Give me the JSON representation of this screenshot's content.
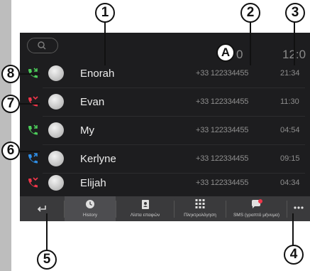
{
  "top": {
    "right_partial": "0",
    "time_partial": "12:0"
  },
  "calls": [
    {
      "name": "Enorah",
      "number": "+33 122334455",
      "time": "21:34",
      "type": "incoming",
      "color": "#4ccb5a"
    },
    {
      "name": "Evan",
      "number": "+33 122334455",
      "time": "11:30",
      "type": "missed",
      "color": "#f0364a"
    },
    {
      "name": "My",
      "number": "+33 122334455",
      "time": "04:54",
      "type": "incoming",
      "color": "#4ccb5a"
    },
    {
      "name": "Kerlyne",
      "number": "+33 122334455",
      "time": "09:15",
      "type": "outgoing",
      "color": "#2f8fe8"
    },
    {
      "name": "Elijah",
      "number": "+33 122334455",
      "time": "04:34",
      "type": "missed",
      "color": "#f0364a"
    }
  ],
  "tabs": [
    {
      "label": "History",
      "icon": "clock-icon"
    },
    {
      "label": "Λίστα επαφών",
      "icon": "contacts-icon"
    },
    {
      "label": "Πληκτρολόγηση",
      "icon": "keypad-icon"
    },
    {
      "label": "SMS (γραπτό μήνυμα)",
      "icon": "sms-icon"
    }
  ],
  "callouts": {
    "m1": "1",
    "m2": "2",
    "m3": "3",
    "m4": "4",
    "m5": "5",
    "m6": "6",
    "m7": "7",
    "m8": "8",
    "mA": "A"
  },
  "colors": {
    "incoming": "#4ccb5a",
    "missed": "#f0364a",
    "outgoing": "#2f8fe8",
    "screen_bg": "#1d1d1f",
    "tabbar_bg": "#3a3a3c"
  }
}
